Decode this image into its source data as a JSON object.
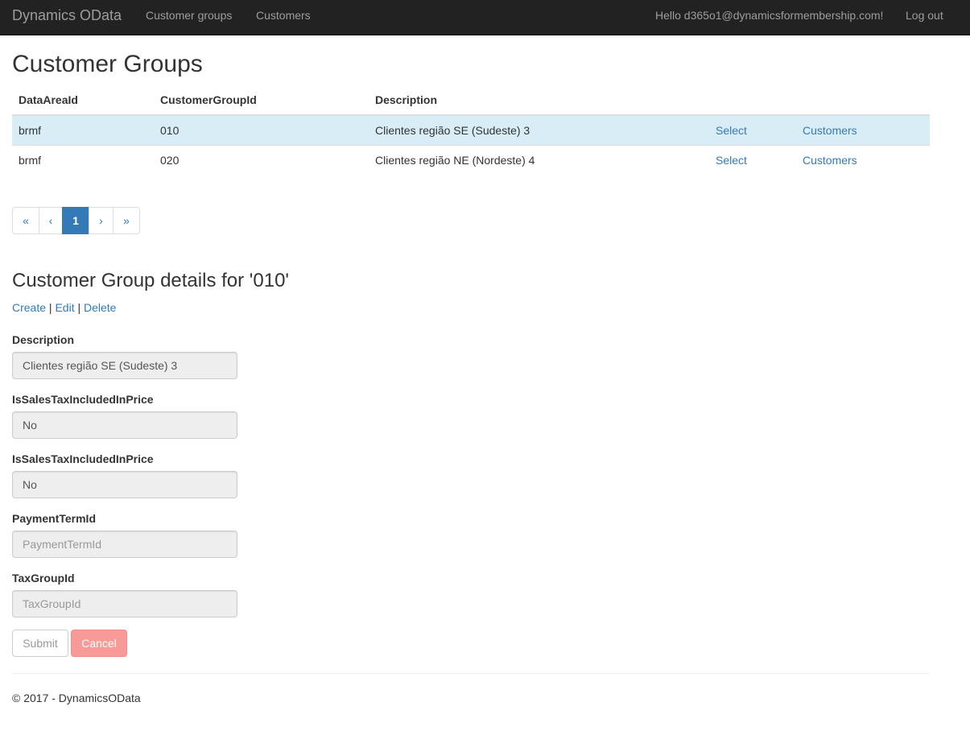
{
  "navbar": {
    "brand": "Dynamics OData",
    "links": [
      "Customer groups",
      "Customers"
    ],
    "greeting": "Hello d365o1@dynamicsformembership.com!",
    "logout": "Log out",
    "background_color": "#222222"
  },
  "page": {
    "title": "Customer Groups"
  },
  "table": {
    "headers": [
      "DataAreaId",
      "CustomerGroupId",
      "Description"
    ],
    "rows": [
      {
        "data_area_id": "brmf",
        "customer_group_id": "010",
        "description": "Clientes região SE (Sudeste) 3",
        "select_label": "Select",
        "customers_label": "Customers",
        "selected": true
      },
      {
        "data_area_id": "brmf",
        "customer_group_id": "020",
        "description": "Clientes região NE (Nordeste) 4",
        "select_label": "Select",
        "customers_label": "Customers",
        "selected": false
      }
    ],
    "selected_row_color": "#d9edf7"
  },
  "pagination": {
    "first": "«",
    "prev": "‹",
    "current": "1",
    "next": "›",
    "last": "»"
  },
  "details": {
    "title": "Customer Group details for '010'",
    "actions": {
      "create": "Create",
      "edit": "Edit",
      "delete": "Delete",
      "separator": "|"
    },
    "fields": [
      {
        "label": "Description",
        "value": "Clientes região SE (Sudeste) 3",
        "placeholder": ""
      },
      {
        "label": "IsSalesTaxIncludedInPrice",
        "value": "No",
        "placeholder": ""
      },
      {
        "label": "IsSalesTaxIncludedInPrice",
        "value": "No",
        "placeholder": ""
      },
      {
        "label": "PaymentTermId",
        "value": "",
        "placeholder": "PaymentTermId"
      },
      {
        "label": "TaxGroupId",
        "value": "",
        "placeholder": "TaxGroupId"
      }
    ],
    "submit_label": "Submit",
    "cancel_label": "Cancel"
  },
  "footer": {
    "text": "© 2017 - DynamicsOData"
  },
  "colors": {
    "link": "#337ab7",
    "active_page": "#337ab7",
    "cancel_button": "#f79a98"
  }
}
